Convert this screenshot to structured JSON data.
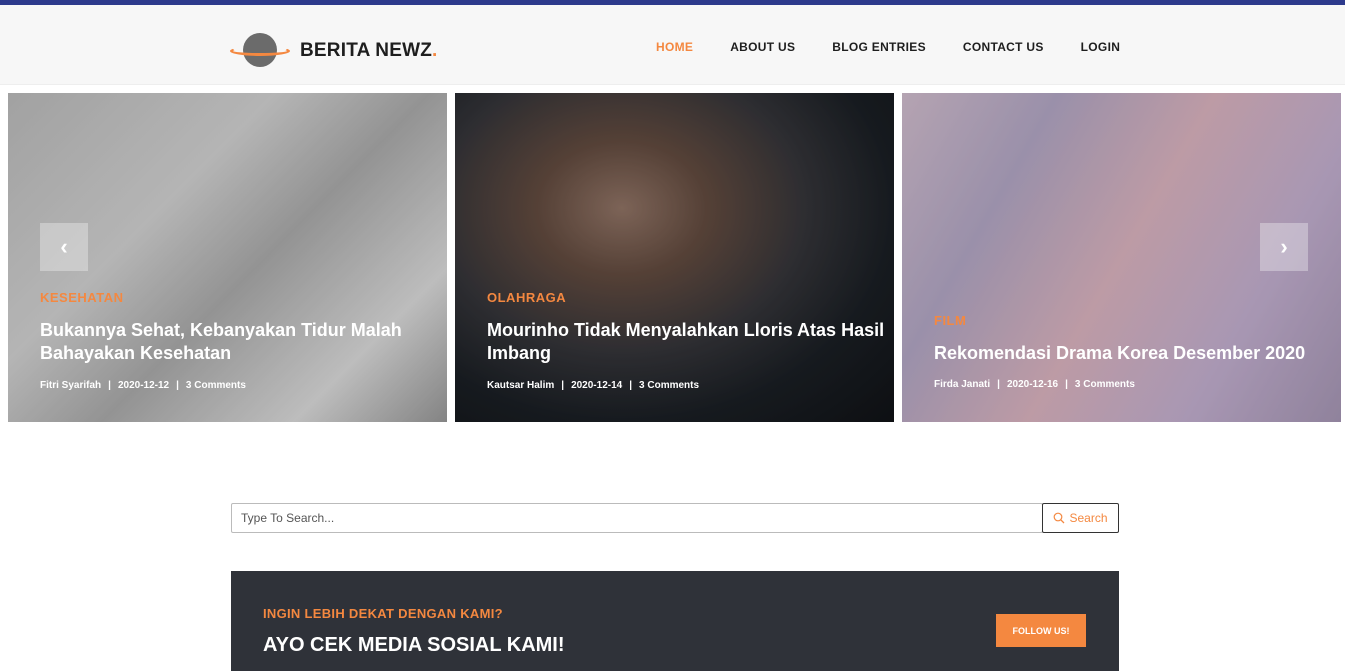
{
  "header": {
    "brand": "BERITA NEWZ",
    "brand_dot": ".",
    "nav": [
      {
        "label": "HOME",
        "active": true
      },
      {
        "label": "ABOUT US"
      },
      {
        "label": "BLOG ENTRIES"
      },
      {
        "label": "CONTACT US"
      },
      {
        "label": "LOGIN"
      }
    ]
  },
  "slider": {
    "prev_icon": "‹",
    "next_icon": "›",
    "slides": [
      {
        "category": "KESEHATAN",
        "title": "Bukannya Sehat, Kebanyakan Tidur Malah Bahayakan Kesehatan",
        "author": "Fitri Syarifah",
        "date": "2020-12-12",
        "comments": "3 Comments"
      },
      {
        "category": "OLAHRAGA",
        "title": "Mourinho Tidak Menyalahkan Lloris Atas Hasil Imbang",
        "author": "Kautsar Halim",
        "date": "2020-12-14",
        "comments": "3 Comments"
      },
      {
        "category": "FILM",
        "title": "Rekomendasi Drama Korea Desember 2020",
        "author": "Firda Janati",
        "date": "2020-12-16",
        "comments": "3 Comments"
      }
    ]
  },
  "search": {
    "placeholder": "Type To Search...",
    "button_label": "Search"
  },
  "cta": {
    "subtitle": "INGIN LEBIH DEKAT DENGAN KAMI?",
    "heading": "AYO CEK MEDIA SOSIAL KAMI!",
    "button_label": "FOLLOW US!"
  },
  "colors": {
    "accent": "#f48840",
    "topbar": "#2d3a8c",
    "dark": "#2f3239"
  },
  "icons": [
    "planet-logo-icon",
    "chevron-left-icon",
    "chevron-right-icon",
    "search-icon"
  ]
}
